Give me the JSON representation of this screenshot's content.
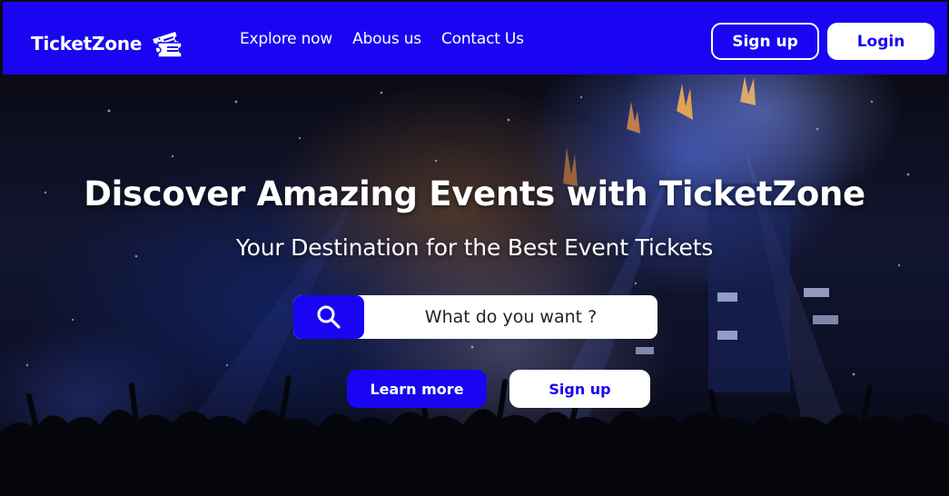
{
  "brand": {
    "name": "TicketZone",
    "icon": "ticket-icon"
  },
  "nav": {
    "links": [
      "Explore now",
      "Abous us",
      "Contact Us"
    ],
    "signup_label": "Sign up",
    "login_label": "Login"
  },
  "hero": {
    "title": "Discover Amazing Events with TicketZone",
    "subtitle": "Your Destination for the Best Event Tickets",
    "search_placeholder": "What do you want ?",
    "search_icon": "search-icon",
    "learn_more_label": "Learn more",
    "signup_label": "Sign up",
    "background": "concert crowd with stage lights"
  },
  "colors": {
    "brand_blue": "#1a05f2",
    "white": "#ffffff"
  }
}
